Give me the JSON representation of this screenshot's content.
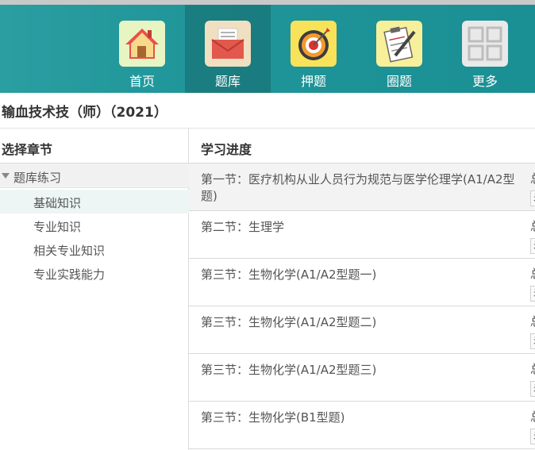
{
  "nav": {
    "items": [
      {
        "label": "首页",
        "icon": "home-icon"
      },
      {
        "label": "题库",
        "icon": "envelope-icon"
      },
      {
        "label": "押题",
        "icon": "target-icon"
      },
      {
        "label": "圈题",
        "icon": "clipboard-pen-icon"
      },
      {
        "label": "更多",
        "icon": "grid-icon"
      }
    ],
    "active_index": 1
  },
  "page": {
    "title": "输血技术技（师）（2021）"
  },
  "sidebar": {
    "heading": "选择章节",
    "group_label": "题库练习",
    "items": [
      {
        "label": "基础知识",
        "active": true
      },
      {
        "label": "专业知识"
      },
      {
        "label": "相关专业知识"
      },
      {
        "label": "专业实践能力"
      }
    ]
  },
  "main": {
    "heading": "学习进度",
    "rows": [
      {
        "title": "第一节：医疗机构从业人员行为规范与医学伦理学(A1/A2型题)",
        "extra": "总",
        "btn": "未"
      },
      {
        "title": "第二节：生理学",
        "extra": "总",
        "btn": "未"
      },
      {
        "title": "第三节：生物化学(A1/A2型题一)",
        "extra": "总",
        "btn": "未"
      },
      {
        "title": "第三节：生物化学(A1/A2型题二)",
        "extra": "总",
        "btn": "未"
      },
      {
        "title": "第三节：生物化学(A1/A2型题三)",
        "extra": "总",
        "btn": "未"
      },
      {
        "title": "第三节：生物化学(B1型题)",
        "extra": "总",
        "btn": "未"
      }
    ]
  },
  "colors": {
    "nav_bg": "#1f9599",
    "nav_active": "#187e82",
    "text": "#555555",
    "accent_row": "#edf6f5"
  }
}
